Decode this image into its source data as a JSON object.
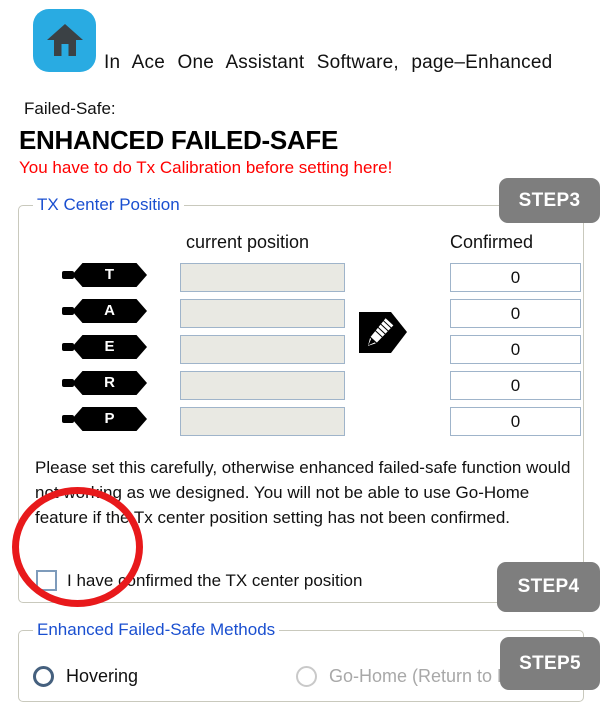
{
  "header": {
    "home_icon": "home-icon",
    "breadcrumb_text": "In Ace One Assistant Software, page–Enhanced",
    "subtitle": "Failed-Safe:",
    "title": "ENHANCED FAILED-SAFE",
    "warning": "You have to do Tx Calibration before setting here!",
    "warning_color": "#FF0000"
  },
  "tx_panel": {
    "legend": "TX Center Position",
    "legend_color": "#1A4FD0",
    "columns": {
      "current": "current position",
      "confirmed": "Confirmed"
    },
    "rows": [
      {
        "channel": "T",
        "current": "",
        "confirmed": "0"
      },
      {
        "channel": "A",
        "current": "",
        "confirmed": "0"
      },
      {
        "channel": "E",
        "current": "",
        "confirmed": "0"
      },
      {
        "channel": "R",
        "current": "",
        "confirmed": "0"
      },
      {
        "channel": "P",
        "current": "",
        "confirmed": "0"
      }
    ],
    "pencil_icon": "pencil-edit-icon",
    "note": "Please set this carefully, otherwise enhanced failed-safe function would not working as we designed. You will not be able to use Go-Home feature if the Tx center position setting has not been confirmed.",
    "confirm_checkbox_label": "I have confirmed the TX center position",
    "confirm_checkbox_checked": false
  },
  "methods_panel": {
    "legend": "Enhanced Failed-Safe Methods",
    "options": [
      {
        "label": "Hovering",
        "selected": true,
        "disabled": false
      },
      {
        "label": "Go-Home (Return to Home)",
        "selected": false,
        "disabled": true
      }
    ]
  },
  "steps": {
    "step3": "STEP3",
    "step4": "STEP4",
    "step5": "STEP5",
    "badge_color": "#7E7E7E"
  },
  "annotation": {
    "shape": "red-ellipse-highlight",
    "color": "#E8191B"
  }
}
